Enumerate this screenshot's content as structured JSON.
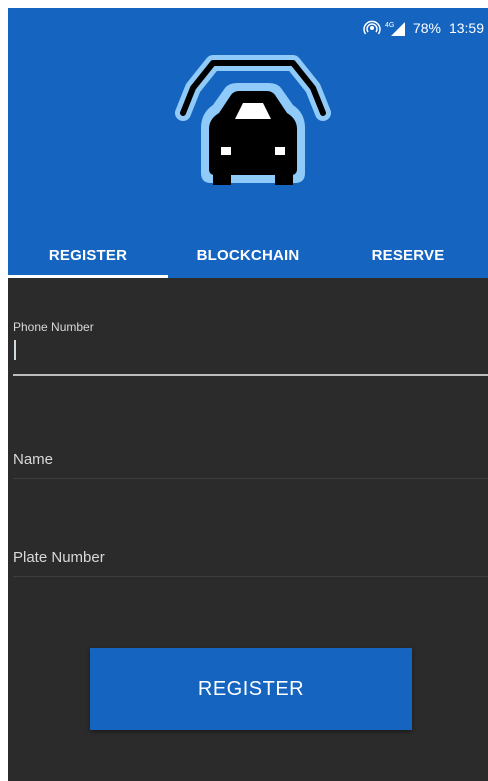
{
  "status_bar": {
    "battery": "78%",
    "time": "13:59",
    "icons": [
      "hotspot-icon",
      "signal-icon"
    ]
  },
  "app": {
    "logo_icon": "car-garage-icon",
    "colors": {
      "primary": "#1565c0",
      "background": "#2b2b2b"
    }
  },
  "tabs": [
    {
      "label": "REGISTER",
      "active": true
    },
    {
      "label": "BLOCKCHAIN",
      "active": false
    },
    {
      "label": "RESERVE",
      "active": false
    }
  ],
  "form": {
    "phone": {
      "label": "Phone Number",
      "value": ""
    },
    "name": {
      "placeholder": "Name",
      "value": ""
    },
    "plate": {
      "placeholder": "Plate Number",
      "value": ""
    },
    "submit_label": "REGISTER"
  }
}
